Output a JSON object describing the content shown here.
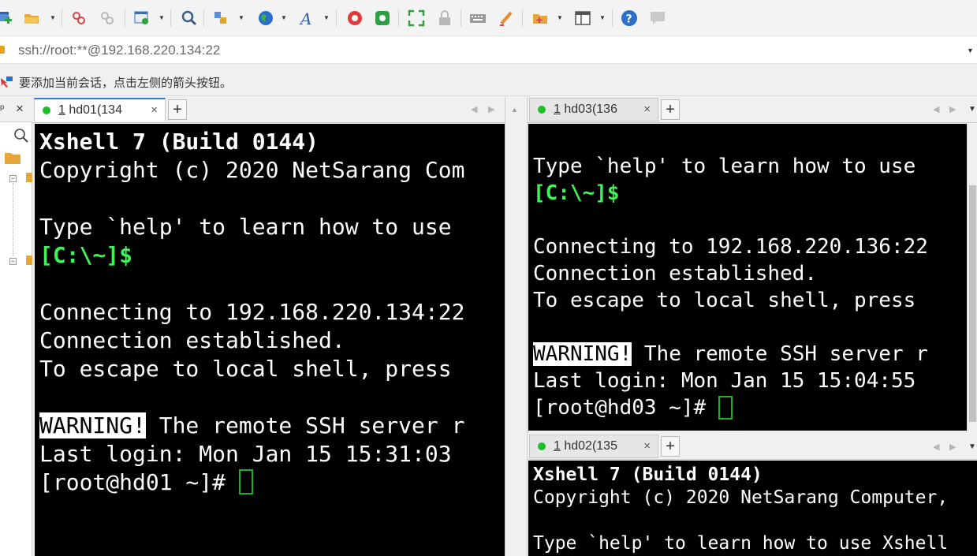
{
  "toolbar": {
    "icons": [
      "new-session-icon",
      "open-folder-icon",
      "disconnect-icon",
      "reconnect-icon",
      "properties-icon",
      "find-icon",
      "transfer-icon",
      "globe-icon",
      "font-icon",
      "xftp-icon",
      "xmanager-icon",
      "fullscreen-icon",
      "lock-icon",
      "keyboard-icon",
      "highlight-icon",
      "new-tab-folder-icon",
      "layout-icon",
      "help-icon",
      "chat-icon"
    ]
  },
  "address": {
    "value": "ssh://root:**@192.168.220.134:22"
  },
  "hint": {
    "text": "要添加当前会话，点击左侧的箭头按钮。"
  },
  "sidebar": {
    "close_label": "×"
  },
  "left_pane": {
    "tab": {
      "num": "1",
      "label": " hd01(134",
      "close": "×"
    },
    "add": "+",
    "lines": [
      "Xshell 7 (Build 0144)",
      "Copyright (c) 2020 NetSarang Com",
      "",
      "Type `help' to learn how to use",
      "[C:\\~]$",
      "",
      "Connecting to 192.168.220.134:22",
      "Connection established.",
      "To escape to local shell, press",
      "",
      "WARNING!",
      " The remote SSH server r",
      "Last login: Mon Jan 15 15:31:03",
      "[root@hd01 ~]# "
    ]
  },
  "right_top_pane": {
    "tab": {
      "num": "1",
      "label": " hd03(136",
      "close": "×"
    },
    "add": "+",
    "lines": [
      "Type `help' to learn how to use",
      "[C:\\~]$",
      "",
      "Connecting to 192.168.220.136:22",
      "Connection established.",
      "To escape to local shell, press",
      "",
      "WARNING!",
      " The remote SSH server r",
      "Last login: Mon Jan 15 15:04:55",
      "[root@hd03 ~]# "
    ]
  },
  "right_bottom_pane": {
    "tab": {
      "num": "1",
      "label": " hd02(135",
      "close": "×"
    },
    "add": "+",
    "lines": [
      "Xshell 7 (Build 0144)",
      "Copyright (c) 2020 NetSarang Computer,",
      "",
      "Type `help' to learn how to use Xshell"
    ]
  },
  "colors": {
    "accent": "#2f7fd8",
    "prompt_green": "#3ff25a",
    "status_dot": "#1bbf2a"
  }
}
